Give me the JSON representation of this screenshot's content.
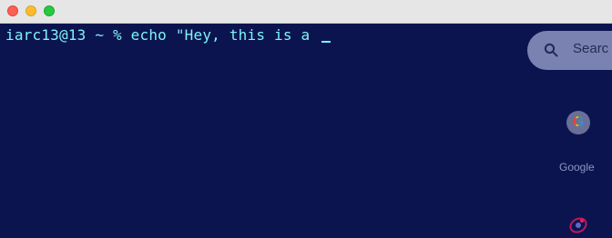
{
  "window": {
    "traffic_lights": [
      "close",
      "minimize",
      "maximize"
    ]
  },
  "terminal": {
    "prompt": "iarc13@13 ~ % ",
    "command": "echo \"Hey, this is a "
  },
  "desktop": {
    "search": {
      "label": "Searc",
      "icon": "search-icon"
    },
    "google": {
      "label": "Google",
      "icon": "google-icon"
    },
    "bottom_app": {
      "icon": "app-icon"
    }
  },
  "colors": {
    "terminal_bg": "#0c1450",
    "terminal_text": "#7ff3f5",
    "titlebar": "#e6e6e6"
  }
}
